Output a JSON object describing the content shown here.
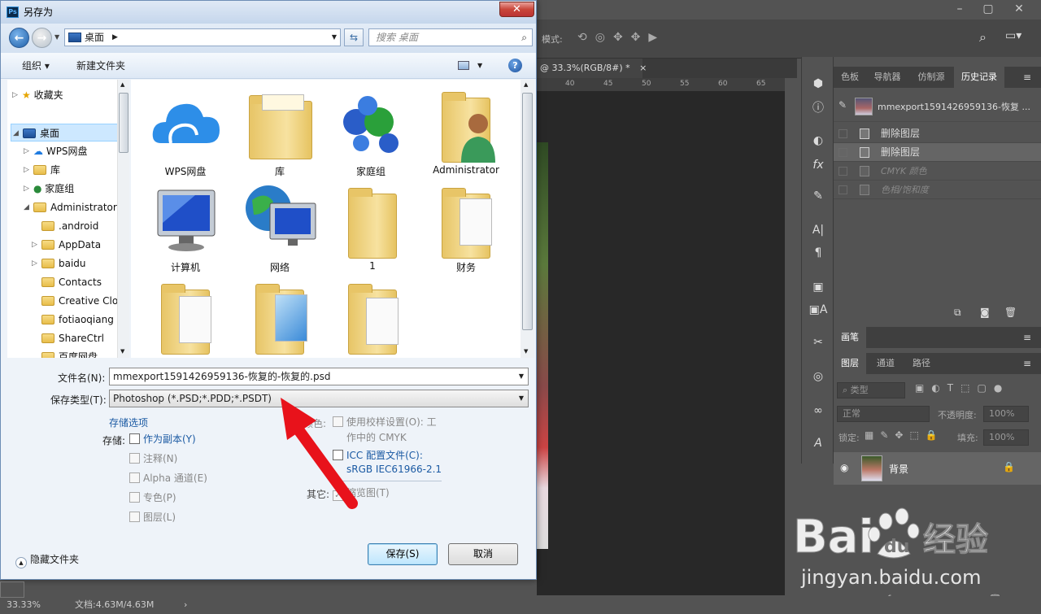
{
  "ps": {
    "doc_tab": "@ 33.3%(RGB/8#) *",
    "doc_tab_close": "×",
    "options_label": "模式:",
    "ruler_ticks": [
      "40",
      "45",
      "50",
      "55",
      "60",
      "65"
    ],
    "panel_top_tabs": [
      "色板",
      "导航器",
      "仿制源",
      "历史记录"
    ],
    "history_snapshot": "mmexport1591426959136-恢复 ...",
    "history_items": [
      {
        "label": "删除图层",
        "state": "normal"
      },
      {
        "label": "删除图层",
        "state": "selected"
      },
      {
        "label": "CMYK 颜色",
        "state": "dim"
      },
      {
        "label": "色相/饱和度",
        "state": "dim"
      }
    ],
    "brush_tab": "画笔",
    "layer_tabs": [
      "图层",
      "通道",
      "路径"
    ],
    "layer_filter": "类型",
    "blend_mode": "正常",
    "opacity_label": "不透明度:",
    "opacity_value": "100%",
    "lock_label": "锁定:",
    "fill_label": "填充:",
    "fill_value": "100%",
    "layer_name": "背景",
    "status_zoom": "33.33%",
    "status_doc": "文档:4.63M/4.63M",
    "tool_icons": [
      "3d-icon",
      "info-icon",
      "adjust-icon",
      "fx-icon",
      "brush-preset-icon",
      "char-icon",
      "para-icon",
      "char-style-icon",
      "para-style-icon",
      "tools-icon",
      "path-icon",
      "cc-libraries-icon",
      "glyph-icon"
    ]
  },
  "watermark": {
    "logo": "Bai du 经验",
    "url": "jingyan.baidu.com"
  },
  "dialog": {
    "title": "另存为",
    "close": "✕",
    "address": "桌面",
    "search_placeholder": "搜索 桌面",
    "organize": "组织 ▾",
    "new_folder": "新建文件夹",
    "nav_tree": [
      {
        "label": "收藏夹",
        "indent": 0,
        "icon": "star-icon"
      },
      {
        "label": "桌面",
        "indent": 0,
        "icon": "desktop-icon",
        "selected": true
      },
      {
        "label": "WPS网盘",
        "indent": 1,
        "icon": "cloud-icon"
      },
      {
        "label": "库",
        "indent": 1,
        "icon": "library-icon"
      },
      {
        "label": "家庭组",
        "indent": 1,
        "icon": "homegroup-icon"
      },
      {
        "label": "Administrator",
        "indent": 1,
        "icon": "user-icon"
      },
      {
        "label": ".android",
        "indent": 2,
        "icon": "folder-icon"
      },
      {
        "label": "AppData",
        "indent": 2,
        "icon": "folder-icon"
      },
      {
        "label": "baidu",
        "indent": 2,
        "icon": "folder-icon"
      },
      {
        "label": "Contacts",
        "indent": 2,
        "icon": "folder-icon"
      },
      {
        "label": "Creative Clo",
        "indent": 2,
        "icon": "folder-icon"
      },
      {
        "label": "fotiaoqiang",
        "indent": 2,
        "icon": "folder-icon"
      },
      {
        "label": "ShareCtrl",
        "indent": 2,
        "icon": "folder-icon"
      },
      {
        "label": "百度网盘",
        "indent": 2,
        "icon": "folder-icon"
      }
    ],
    "items": [
      {
        "label": "WPS网盘",
        "kind": "cloud"
      },
      {
        "label": "库",
        "kind": "library"
      },
      {
        "label": "家庭组",
        "kind": "homegroup"
      },
      {
        "label": "Administrator",
        "kind": "user"
      },
      {
        "label": "计算机",
        "kind": "computer"
      },
      {
        "label": "网络",
        "kind": "network"
      },
      {
        "label": "1",
        "kind": "folder"
      },
      {
        "label": "财务",
        "kind": "folder-docs"
      },
      {
        "label": "",
        "kind": "folder-docs"
      },
      {
        "label": "",
        "kind": "folder-photo"
      },
      {
        "label": "",
        "kind": "folder-docs"
      }
    ],
    "filename_label": "文件名(N):",
    "filename_value": "mmexport1591426959136-恢复的-恢复的.psd",
    "filetype_label": "保存类型(T):",
    "filetype_value": "Photoshop (*.PSD;*.PDD;*.PSDT)",
    "save_options_link": "存储选项",
    "save_label": "存储:",
    "opt_copy": "作为副本(Y)",
    "opt_notes": "注释(N)",
    "opt_alpha": "Alpha 通道(E)",
    "opt_spot": "专色(P)",
    "opt_layers": "图层(L)",
    "color_label": "颜色:",
    "opt_proof": "使用校样设置(O): 工",
    "opt_proof_line2": "作中的 CMYK",
    "opt_icc": "ICC 配置文件(C):",
    "opt_icc_line2": "sRGB IEC61966-2.1",
    "other_label": "其它:",
    "opt_thumb": "缩览图(T)",
    "hide_folders": "隐藏文件夹",
    "save_btn": "保存(S)",
    "cancel_btn": "取消"
  }
}
